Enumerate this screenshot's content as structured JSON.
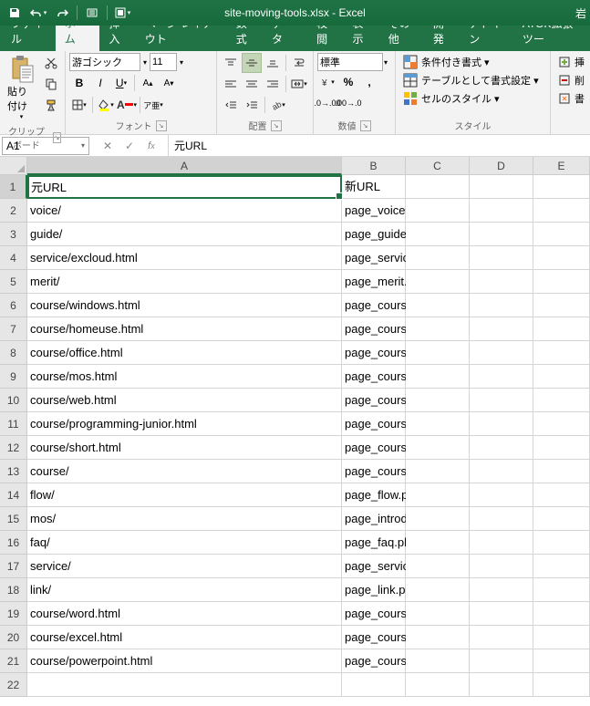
{
  "title": "site-moving-tools.xlsx - Excel",
  "title_right": "岩",
  "tabs": [
    "ファイル",
    "ホーム",
    "挿入",
    "ページ レイアウト",
    "数式",
    "データ",
    "校閲",
    "表示",
    "その他",
    "開発",
    "アドイン",
    "ATOK拡張ツー"
  ],
  "active_tab_index": 1,
  "ribbon": {
    "clipboard": {
      "label": "クリップボード",
      "paste": "貼り付け"
    },
    "font": {
      "label": "フォント",
      "name": "游ゴシック",
      "size": "11"
    },
    "align": {
      "label": "配置"
    },
    "number": {
      "label": "数値",
      "format": "標準"
    },
    "styles": {
      "label": "スタイル",
      "item1": "条件付き書式 ▾",
      "item2": "テーブルとして書式設定 ▾",
      "item3": "セルのスタイル ▾",
      "cells1": "挿",
      "cells2": "削",
      "cells3": "書"
    }
  },
  "namebox": "A1",
  "formula": "元URL",
  "columns": [
    "A",
    "B",
    "C",
    "D",
    "E"
  ],
  "chart_data": {
    "type": "table",
    "headers": [
      "元URL",
      "新URL"
    ],
    "rows": [
      [
        "voice/",
        "page_voice.php"
      ],
      [
        "guide/",
        "page_guide.php"
      ],
      [
        "service/excloud.html",
        "page_service_excloud.php"
      ],
      [
        "merit/",
        "page_merit.php"
      ],
      [
        "course/windows.html",
        "page_course_windows.php"
      ],
      [
        "course/homeuse.html",
        "page_course_homeuse.php"
      ],
      [
        "course/office.html",
        "page_course_office.php"
      ],
      [
        "course/mos.html",
        "page_course_mos.php"
      ],
      [
        "course/web.html",
        "page_course_web.php"
      ],
      [
        "course/programming-junior.html",
        "page_course_programming-junior.php"
      ],
      [
        "course/short.html",
        "page_course_short.php"
      ],
      [
        "course/",
        "page_course.php"
      ],
      [
        "flow/",
        "page_flow.php"
      ],
      [
        "mos/",
        "page_introduction_mos.php"
      ],
      [
        "faq/",
        "page_faq.php"
      ],
      [
        "service/",
        "page_service.php"
      ],
      [
        "link/",
        "page_link.php"
      ],
      [
        "course/word.html",
        "page_course_word.php"
      ],
      [
        "course/excel.html",
        "page_course_excel.php"
      ],
      [
        "course/powerpoint.html",
        "page_course_powerpoint.php"
      ]
    ]
  },
  "total_rows": 22
}
